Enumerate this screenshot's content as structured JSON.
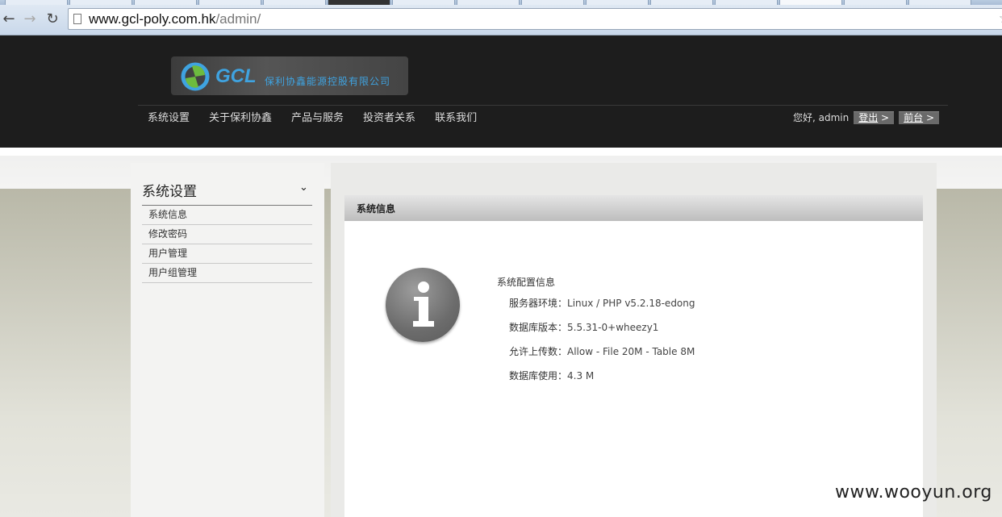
{
  "browser": {
    "url_host": "www.gcl-poly.com.hk",
    "url_path": "/admin/"
  },
  "header": {
    "logo_brand": "GCL",
    "logo_company": "保利协鑫能源控股有限公司",
    "nav": [
      "系统设置",
      "关于保利协鑫",
      "产品与服务",
      "投资者关系",
      "联系我们"
    ],
    "greeting": "您好, admin",
    "logout_label": "登出",
    "frontend_label": "前台"
  },
  "sidebar": {
    "title": "系统设置",
    "items": [
      {
        "label": "系统信息"
      },
      {
        "label": "修改密码"
      },
      {
        "label": "用户管理"
      },
      {
        "label": "用户组管理"
      }
    ]
  },
  "main": {
    "panel_title": "系统信息",
    "info_heading": "系统配置信息",
    "rows": [
      {
        "label": "服务器环境：",
        "value": "Linux / PHP v5.2.18-edong"
      },
      {
        "label": "数据库版本：",
        "value": "5.5.31-0+wheezy1"
      },
      {
        "label": "允许上传数：",
        "value": "Allow - File 20M - Table 8M"
      },
      {
        "label": "数据库使用：",
        "value": "4.3 M"
      }
    ]
  },
  "watermark": "www.wooyun.org"
}
